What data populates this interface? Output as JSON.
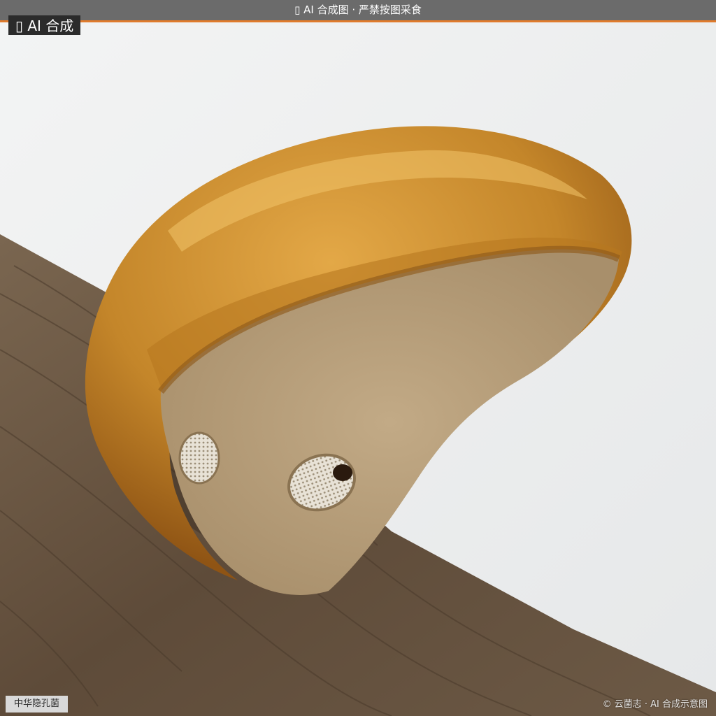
{
  "banner": {
    "text": "▯ AI 合成图 · 严禁按图采食",
    "bg_color": "#6b6b6b",
    "accent_color": "#e07b2c"
  },
  "badge": {
    "text": "▯ AI 合成"
  },
  "photo": {
    "subject": "bracket-fungus-on-branch",
    "colors": {
      "background": "#eef0f0",
      "cap": "#c98a2a",
      "pore_surface": "#b59c78",
      "wood": "#6e5a45"
    }
  },
  "caption": {
    "species": "中华隐孔菌",
    "credit": "© 云菌志 · AI 合成示意图"
  }
}
